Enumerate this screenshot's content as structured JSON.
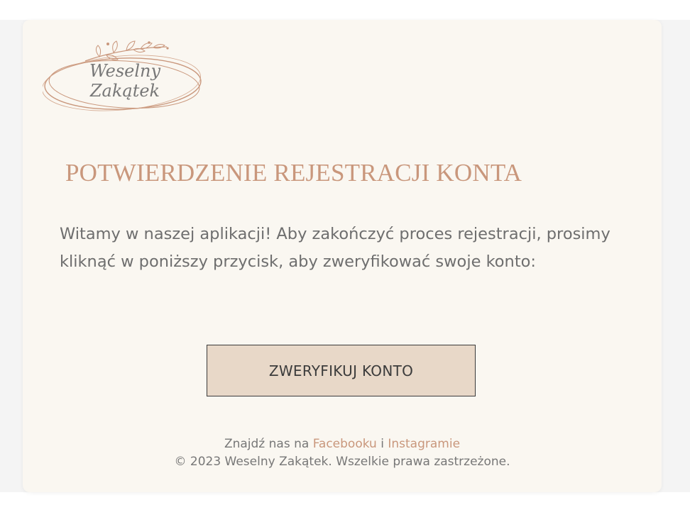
{
  "logo": {
    "line1": "Weselny",
    "line2": "Zakątek"
  },
  "title": "POTWIERDZENIE REJESTRACJI KONTA",
  "intro": "Witamy w naszej aplikacji! Aby zakończyć proces rejestracji, prosimy kliknąć w poniższy przycisk, aby zweryfikować swoje konto:",
  "button": {
    "label": "ZWERYFIKUJ KONTO"
  },
  "footer": {
    "prefix": "Znajdź nas na ",
    "facebook": "Facebooku",
    "connector": " i ",
    "instagram": "Instagramie",
    "copyright": "© 2023 Weselny Zakątek. Wszelkie prawa zastrzeżone."
  },
  "colors": {
    "accent": "#c9977c",
    "button_bg": "#e8d8c8",
    "card_bg": "#faf7f1",
    "page_bg": "#f4f4f4",
    "text": "#6e6e6e"
  }
}
